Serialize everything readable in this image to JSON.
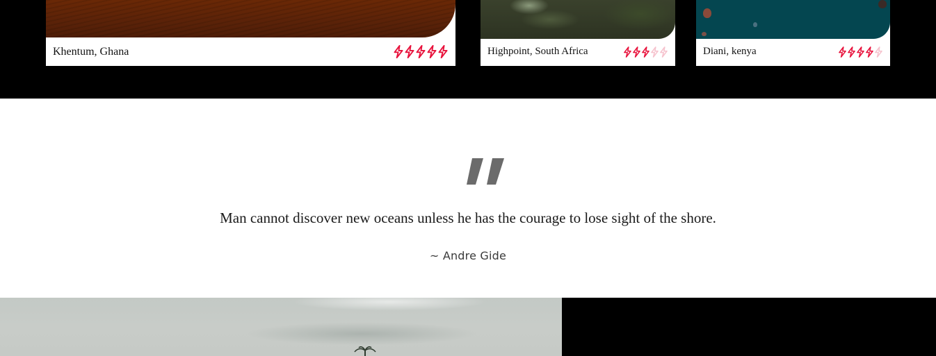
{
  "destinations": [
    {
      "place": "Khentum, Ghana",
      "rating": 5,
      "max_rating": 5
    },
    {
      "place": "Highpoint, South Africa",
      "rating": 3,
      "max_rating": 5
    },
    {
      "place": "Diani, kenya",
      "rating": 4,
      "max_rating": 5
    }
  ],
  "colors": {
    "rating_active": "#e8123c",
    "rating_inactive": "#f6c2cd",
    "quote_mark": "#6b6b6b",
    "band_background": "#000000"
  },
  "quote": {
    "text": "Man cannot discover new oceans unless he has the courage to lose sight of the shore.",
    "author": "~ Andre Gide",
    "icon": "quote-icon"
  }
}
